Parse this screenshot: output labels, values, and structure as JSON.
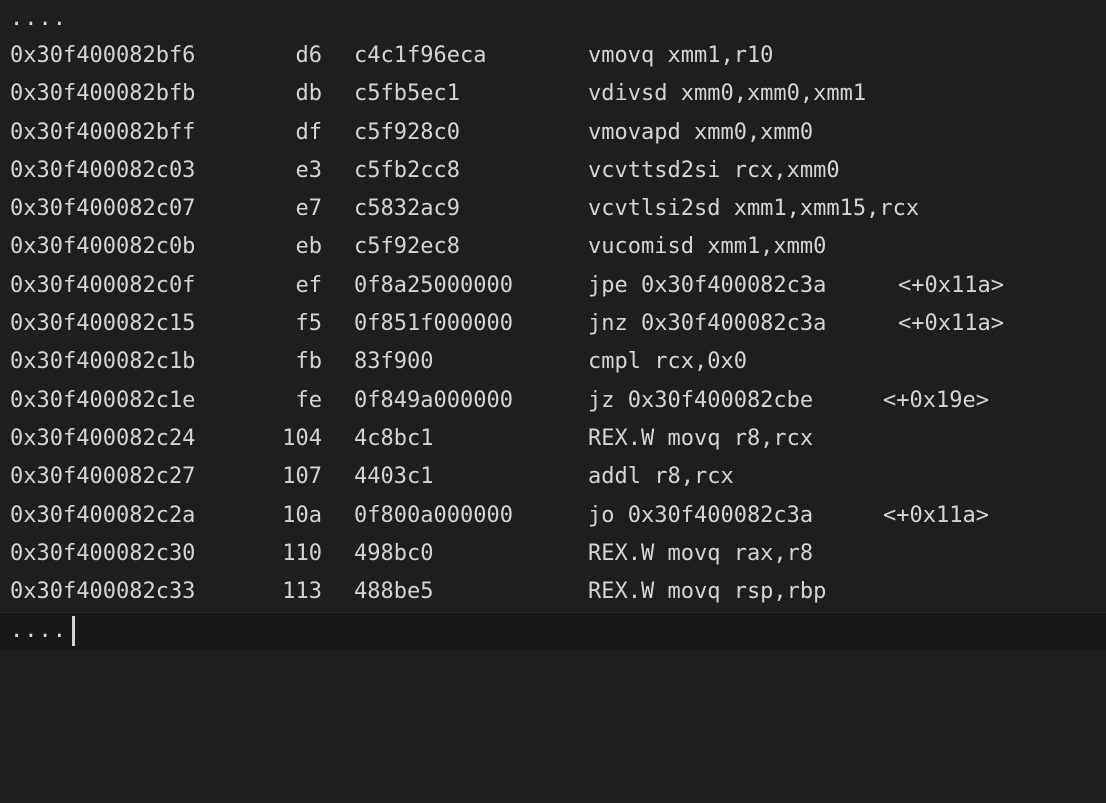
{
  "header": {
    "ellipsis": "...."
  },
  "rows": [
    {
      "address": "0x30f400082bf6",
      "offset": "d6",
      "bytes": "c4c1f96eca",
      "instruction": "vmovq xmm1,r10",
      "ref": ""
    },
    {
      "address": "0x30f400082bfb",
      "offset": "db",
      "bytes": "c5fb5ec1",
      "instruction": "vdivsd xmm0,xmm0,xmm1",
      "ref": ""
    },
    {
      "address": "0x30f400082bff",
      "offset": "df",
      "bytes": "c5f928c0",
      "instruction": "vmovapd xmm0,xmm0",
      "ref": ""
    },
    {
      "address": "0x30f400082c03",
      "offset": "e3",
      "bytes": "c5fb2cc8",
      "instruction": "vcvttsd2si rcx,xmm0",
      "ref": ""
    },
    {
      "address": "0x30f400082c07",
      "offset": "e7",
      "bytes": "c5832ac9",
      "instruction": "vcvtlsi2sd xmm1,xmm15,rcx",
      "ref": ""
    },
    {
      "address": "0x30f400082c0b",
      "offset": "eb",
      "bytes": "c5f92ec8",
      "instruction": "vucomisd xmm1,xmm0",
      "ref": ""
    },
    {
      "address": "0x30f400082c0f",
      "offset": "ef",
      "bytes": "0f8a25000000",
      "instruction": "jpe 0x30f400082c3a",
      "ref": "<+0x11a>"
    },
    {
      "address": "0x30f400082c15",
      "offset": "f5",
      "bytes": "0f851f000000",
      "instruction": "jnz 0x30f400082c3a",
      "ref": "<+0x11a>"
    },
    {
      "address": "0x30f400082c1b",
      "offset": "fb",
      "bytes": "83f900",
      "instruction": "cmpl rcx,0x0",
      "ref": ""
    },
    {
      "address": "0x30f400082c1e",
      "offset": "fe",
      "bytes": "0f849a000000",
      "instruction": "jz 0x30f400082cbe",
      "ref": "<+0x19e>"
    },
    {
      "address": "0x30f400082c24",
      "offset": "104",
      "bytes": "4c8bc1",
      "instruction": "REX.W movq r8,rcx",
      "ref": ""
    },
    {
      "address": "0x30f400082c27",
      "offset": "107",
      "bytes": "4403c1",
      "instruction": "addl r8,rcx",
      "ref": ""
    },
    {
      "address": "0x30f400082c2a",
      "offset": "10a",
      "bytes": "0f800a000000",
      "instruction": "jo 0x30f400082c3a",
      "ref": "<+0x11a>"
    },
    {
      "address": "0x30f400082c30",
      "offset": "110",
      "bytes": "498bc0",
      "instruction": "REX.W movq rax,r8",
      "ref": ""
    },
    {
      "address": "0x30f400082c33",
      "offset": "113",
      "bytes": "488be5",
      "instruction": "REX.W movq rsp,rbp",
      "ref": ""
    }
  ],
  "input": {
    "value": "...."
  }
}
